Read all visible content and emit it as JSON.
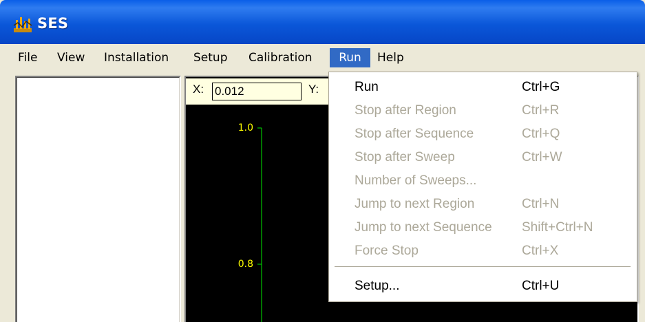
{
  "window": {
    "title": "SES",
    "icon": "ses-app-icon",
    "titlebar_color": "#0b57d9"
  },
  "menubar": {
    "items": [
      {
        "label": "File"
      },
      {
        "label": "View"
      },
      {
        "label": "Installation"
      },
      {
        "label": "Setup"
      },
      {
        "label": "Calibration"
      },
      {
        "label": "Run",
        "active": true
      },
      {
        "label": "Help"
      }
    ],
    "active_color": "#316ac5"
  },
  "coords": {
    "x_label": "X:",
    "x_value": "0.012",
    "y_label": "Y:"
  },
  "plot": {
    "y_ticks": [
      "1.0",
      "0.8"
    ],
    "axis_color": "#00c000",
    "tick_label_color": "#ffff00",
    "background": "#000000"
  },
  "run_menu": {
    "items": [
      {
        "label": "Run",
        "shortcut": "Ctrl+G",
        "enabled": true
      },
      {
        "label": "Stop after Region",
        "shortcut": "Ctrl+R",
        "enabled": false
      },
      {
        "label": "Stop after Sequence",
        "shortcut": "Ctrl+Q",
        "enabled": false
      },
      {
        "label": "Stop after Sweep",
        "shortcut": "Ctrl+W",
        "enabled": false
      },
      {
        "label": "Number of Sweeps...",
        "shortcut": "",
        "enabled": false
      },
      {
        "label": "Jump to next Region",
        "shortcut": "Ctrl+N",
        "enabled": false
      },
      {
        "label": "Jump to next Sequence",
        "shortcut": "Shift+Ctrl+N",
        "enabled": false
      },
      {
        "label": "Force Stop",
        "shortcut": "Ctrl+X",
        "enabled": false
      },
      {
        "label": "Setup...",
        "shortcut": "Ctrl+U",
        "enabled": true
      }
    ],
    "disabled_color": "#aca899"
  }
}
